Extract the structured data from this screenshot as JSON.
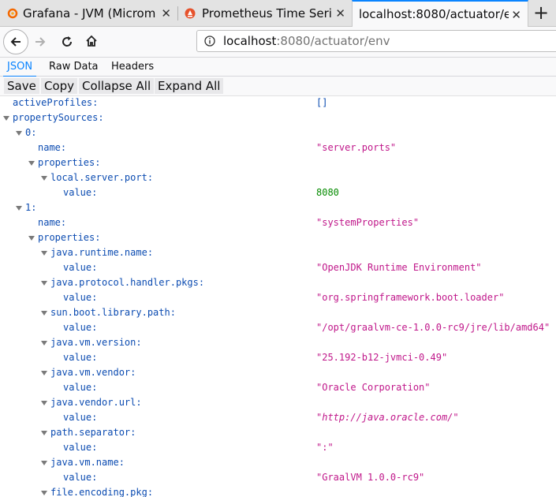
{
  "browser": {
    "tabs": [
      {
        "title": "Grafana - JVM (Microm",
        "close": "✕"
      },
      {
        "title": "Prometheus Time Seri",
        "close": "✕"
      },
      {
        "title": "localhost:8080/actuator/e",
        "close": "✕"
      }
    ],
    "new_tab": "+",
    "url_host": "localhost",
    "url_path": ":8080/actuator/env"
  },
  "viewer": {
    "tabs": [
      "JSON",
      "Raw Data",
      "Headers"
    ],
    "toolbar": [
      "Save",
      "Copy",
      "Collapse All",
      "Expand All"
    ]
  },
  "json": {
    "rows": [
      {
        "key": "activeProfiles:",
        "value": "[]"
      },
      {
        "key": "propertySources:",
        "value": ""
      },
      {
        "key": "0:",
        "value": ""
      },
      {
        "key": "name:",
        "value": "\"server.ports\""
      },
      {
        "key": "properties:",
        "value": ""
      },
      {
        "key": "local.server.port:",
        "value": ""
      },
      {
        "key": "value:",
        "value": "8080"
      },
      {
        "key": "1:",
        "value": ""
      },
      {
        "key": "name:",
        "value": "\"systemProperties\""
      },
      {
        "key": "properties:",
        "value": ""
      },
      {
        "key": "java.runtime.name:",
        "value": ""
      },
      {
        "key": "value:",
        "value": "\"OpenJDK Runtime Environment\""
      },
      {
        "key": "java.protocol.handler.pkgs:",
        "value": ""
      },
      {
        "key": "value:",
        "value": "\"org.springframework.boot.loader\""
      },
      {
        "key": "sun.boot.library.path:",
        "value": ""
      },
      {
        "key": "value:",
        "value": "\"/opt/graalvm-ce-1.0.0-rc9/jre/lib/amd64\""
      },
      {
        "key": "java.vm.version:",
        "value": ""
      },
      {
        "key": "value:",
        "value": "\"25.192-b12-jvmci-0.49\""
      },
      {
        "key": "java.vm.vendor:",
        "value": ""
      },
      {
        "key": "value:",
        "value": "\"Oracle Corporation\""
      },
      {
        "key": "java.vendor.url:",
        "value": ""
      },
      {
        "key": "value:",
        "value": "\"http://java.oracle.com/\""
      },
      {
        "key": "path.separator:",
        "value": ""
      },
      {
        "key": "value:",
        "value": "\":\""
      },
      {
        "key": "java.vm.name:",
        "value": ""
      },
      {
        "key": "value:",
        "value": "\"GraalVM 1.0.0-rc9\""
      },
      {
        "key": "file.encoding.pkg:",
        "value": ""
      }
    ]
  },
  "colors": {
    "accent": "#0a84ff",
    "key": "#0b4bb1",
    "string": "#c0178a",
    "number": "#058b00"
  }
}
